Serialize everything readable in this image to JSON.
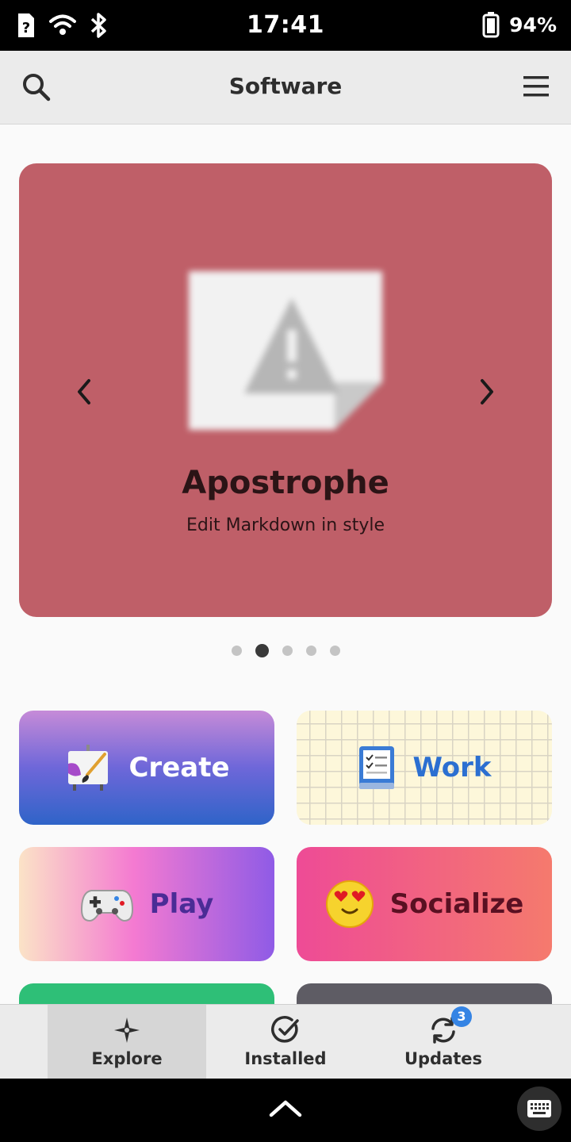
{
  "status_bar": {
    "time": "17:41",
    "battery_percent": "94%",
    "icons": [
      "sim-unknown-icon",
      "wifi-icon",
      "bluetooth-icon",
      "battery-icon"
    ]
  },
  "header": {
    "title": "Software",
    "search_icon": "search-icon",
    "menu_icon": "hamburger-menu-icon"
  },
  "featured": {
    "title": "Apostrophe",
    "subtitle": "Edit Markdown in style",
    "background_color": "#bf5f68",
    "page_count": 5,
    "active_page": 2
  },
  "categories": [
    {
      "label": "Create",
      "icon": "create-easel-icon"
    },
    {
      "label": "Work",
      "icon": "work-checklist-icon"
    },
    {
      "label": "Play",
      "icon": "gamepad-icon"
    },
    {
      "label": "Socialize",
      "icon": "heart-eyes-emoji-icon"
    }
  ],
  "switcher": {
    "items": [
      {
        "label": "Explore",
        "icon": "explore-compass-icon",
        "active": true
      },
      {
        "label": "Installed",
        "icon": "installed-check-icon",
        "active": false
      },
      {
        "label": "Updates",
        "icon": "updates-refresh-icon",
        "active": false,
        "badge": "3"
      }
    ]
  },
  "colors": {
    "accent": "#3584e4",
    "create_gradient_end": "#2f64c8",
    "work_label": "#2b6fd1"
  }
}
